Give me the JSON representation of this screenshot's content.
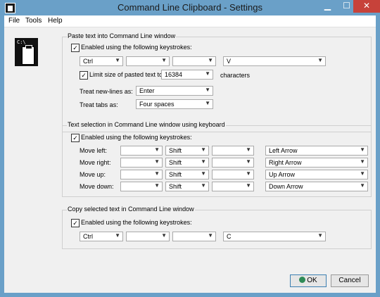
{
  "window": {
    "title": "Command Line Clipboard - Settings"
  },
  "menu": [
    "File",
    "Tools",
    "Help"
  ],
  "icon": {
    "prompt": "C:\\"
  },
  "paste": {
    "title": "Paste text into Command Line window",
    "enabled_label": "Enabled using the following keystrokes:",
    "keys": [
      "Ctrl",
      "",
      "",
      "V"
    ],
    "limit_label": "Limit size of pasted text to",
    "limit_value": "16384",
    "limit_unit": "characters",
    "newlines_label": "Treat new-lines as:",
    "newlines_value": "Enter",
    "tabs_label": "Treat tabs as:",
    "tabs_value": "Four spaces"
  },
  "selection": {
    "title": "Text selection in Command Line window using keyboard",
    "enabled_label": "Enabled using the following keystrokes:",
    "rows": [
      {
        "label": "Move left:",
        "mod1": "",
        "mod2": "Shift",
        "mod3": "",
        "key": "Left Arrow"
      },
      {
        "label": "Move right:",
        "mod1": "",
        "mod2": "Shift",
        "mod3": "",
        "key": "Right Arrow"
      },
      {
        "label": "Move up:",
        "mod1": "",
        "mod2": "Shift",
        "mod3": "",
        "key": "Up Arrow"
      },
      {
        "label": "Move down:",
        "mod1": "",
        "mod2": "Shift",
        "mod3": "",
        "key": "Down Arrow"
      }
    ]
  },
  "copy": {
    "title": "Copy selected text in Command Line window",
    "enabled_label": "Enabled using the following keystrokes:",
    "keys": [
      "Ctrl",
      "",
      "",
      "C"
    ]
  },
  "buttons": {
    "ok": "OK",
    "cancel": "Cancel"
  },
  "checkmark": "✓"
}
